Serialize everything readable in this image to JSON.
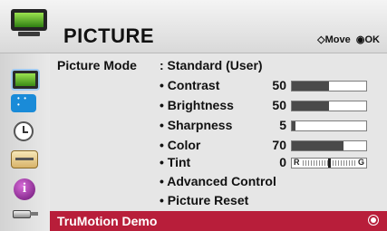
{
  "header": {
    "title": "PICTURE",
    "move_icon": "◇",
    "move_label": "Move",
    "ok_icon": "◉",
    "ok_label": "OK"
  },
  "sidebar": {
    "items": [
      {
        "name": "picture",
        "icon": "tv-icon",
        "active": true
      },
      {
        "name": "screen",
        "icon": "screen-icon"
      },
      {
        "name": "time",
        "icon": "clock-icon"
      },
      {
        "name": "option",
        "icon": "toolbox-icon"
      },
      {
        "name": "info",
        "icon": "info-icon"
      },
      {
        "name": "usb",
        "icon": "usb-icon"
      }
    ]
  },
  "menu": {
    "picture_mode": {
      "label": "Picture Mode",
      "value": ": Standard (User)"
    },
    "contrast": {
      "label": "• Contrast",
      "value": "50",
      "level": 0.5
    },
    "brightness": {
      "label": "• Brightness",
      "value": "50",
      "level": 0.5
    },
    "sharpness": {
      "label": "• Sharpness",
      "value": "5",
      "level": 0.05
    },
    "color": {
      "label": "• Color",
      "value": "70",
      "level": 0.7
    },
    "tint": {
      "label": "• Tint",
      "value": "0",
      "left": "R",
      "right": "G"
    },
    "advanced_control": {
      "label": "• Advanced Control"
    },
    "picture_reset": {
      "label": "• Picture Reset"
    },
    "trumotion_demo": {
      "label": "TruMotion Demo",
      "selected": true
    }
  },
  "colors": {
    "highlight": "#b81e3a",
    "panel": "#e6e6e6",
    "bar_fill": "#4a4a4a"
  }
}
